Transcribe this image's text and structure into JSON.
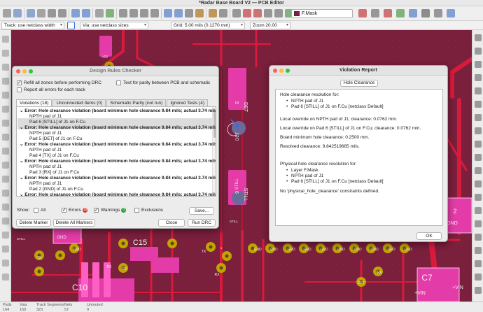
{
  "window": {
    "title": "*Radar Base Board V2 — PCB Editor"
  },
  "toolbar": {
    "active_layer": "F.Mask",
    "icons": [
      "new-board-icon",
      "open-icon",
      "save-icon",
      "page-settings-icon",
      "print-icon",
      "plot-icon",
      "undo-icon",
      "redo-icon",
      "search-icon",
      "refresh-icon",
      "zoom-in-icon",
      "zoom-out-icon",
      "zoom-fit-icon",
      "zoom-selection-icon",
      "rotate-ccw-icon",
      "rotate-cw-icon",
      "flip-icon",
      "lock-icon",
      "unlock-icon",
      "group-icon",
      "netlist-icon",
      "schematic-icon",
      "drc-icon",
      "footprint-editor-icon",
      "footprint-browser-icon",
      "script-icon"
    ],
    "right_icons": [
      "layer-pair-icon",
      "layer-mode-icon",
      "drc-icon",
      "fill-zones-icon",
      "router-icon",
      "scripting-icon",
      "plugin-icon",
      "help-icon"
    ]
  },
  "toolbar2": {
    "track": "Track: use netclass width",
    "via": "Via: use netclass sizes",
    "grid": "Grid: 5.00 mils (0.1270 mm)",
    "zoom": "Zoom 20.00"
  },
  "canvas": {
    "labels": [
      "C15",
      "C10",
      "C7",
      "GND",
      "GND",
      "GND",
      "GND",
      "GND",
      "GND",
      "GND",
      "GND",
      "GND",
      "GND",
      "GND",
      "TX",
      "TX",
      "RX",
      "RX",
      "RX",
      "RX",
      "DET",
      "DET",
      "STILL",
      "STILL",
      "STILL",
      "5",
      "6",
      "DET",
      "STILL",
      "+5V",
      "+5V",
      "+5V",
      "+5V",
      "+VIN",
      "+VIN",
      "GND",
      "2",
      "GND",
      "1"
    ]
  },
  "drc": {
    "title": "Design Rules Checker",
    "opt_refill": "Refill all zones before performing DRC",
    "opt_parity": "Test for parity between PCB and schematic",
    "opt_report_all": "Report all errors for each track",
    "tabs": [
      "Violations (18)",
      "Unconnected Items (0)",
      "Schematic Parity (not run)",
      "Ignored Tests (4)"
    ],
    "violations": [
      {
        "error": "Error: Hole clearance violation (board minimum hole clearance 9.84 mils; actual 3.74 mils)",
        "item1": "NPTH pad of J1",
        "item2": "Pad 6 [STILL] of J1 on F.Cu"
      },
      {
        "error": "Error: Hole clearance violation (board minimum hole clearance 9.84 mils; actual 3.74 mils)",
        "item1": "NPTH pad of J1",
        "item2": "Pad 5 [DET] of J1 on F.Cu"
      },
      {
        "error": "Error: Hole clearance violation (board minimum hole clearance 9.84 mils; actual 3.74 mils)",
        "item1": "NPTH pad of J1",
        "item2": "Pad 4 [TX] of J1 on F.Cu"
      },
      {
        "error": "Error: Hole clearance violation (board minimum hole clearance 9.84 mils; actual 3.74 mils)",
        "item1": "NPTH pad of J1",
        "item2": "Pad 3 [RX] of J1 on F.Cu"
      },
      {
        "error": "Error: Hole clearance violation (board minimum hole clearance 9.84 mils; actual 3.74 mils)",
        "item1": "NPTH pad of J1",
        "item2": "Pad 2 [GND] of J1 on F.Cu"
      },
      {
        "error": "Error: Hole clearance violation (board minimum hole clearance 9.84 mils; actual 3.74 mils)",
        "item1": "NPTH pad of J1",
        "item2": "Pad 1 [+5V] of J1 on F.Cu"
      }
    ],
    "show_label": "Show:",
    "filter_all": "All",
    "filter_errors": "Errors",
    "errors_count": "18",
    "filter_warnings": "Warnings",
    "warnings_count": "0",
    "filter_exclusions": "Exclusions",
    "save_button": "Save...",
    "delete_marker": "Delete Marker",
    "delete_all": "Delete All Markers",
    "close": "Close",
    "run_drc": "Run DRC"
  },
  "report": {
    "title": "Violation Report",
    "tab": "Hole Clearance",
    "heading": "Hole clearance resolution for:",
    "items": [
      "NPTH pad of J1",
      "Pad 6 [STILL] of J1 on F.Cu [netclass Default]"
    ],
    "local1": "Local override on NPTH pad of J1; clearance: 0.0762 mm.",
    "local2": "Local override on Pad 6 [STILL] of J1 on F.Cu; clearance: 0.0762 mm.",
    "board_min": "Board minimum hole clearance: 0.2500 mm.",
    "resolved": "Resolved clearance: 9.842519685 mils.",
    "phys_heading": "Physical hole clearance resolution for:",
    "phys_items": [
      "Layer F.Mask",
      "NPTH pad of J1",
      "Pad 6 [STILL] of J1 on F.Cu [netclass Default]"
    ],
    "no_constraints": "No 'physical_hole_clearance' constraints defined.",
    "ok": "OK"
  },
  "status": {
    "items": [
      {
        "label": "Pads",
        "value": "164"
      },
      {
        "label": "Vias",
        "value": "150"
      },
      {
        "label": "Track Segments",
        "value": "323"
      },
      {
        "label": "Nets",
        "value": "57"
      },
      {
        "label": "Unrouted",
        "value": "0"
      }
    ]
  },
  "colors": {
    "board": "#7a1f3c",
    "track": "#d81b3c",
    "pad": "#e33ba8",
    "via": "#c2a300",
    "silk": "#f0f0f0",
    "accent": "#2a6fdb",
    "error_badge": "#e0322a",
    "warning_badge": "#2a9d3c"
  }
}
